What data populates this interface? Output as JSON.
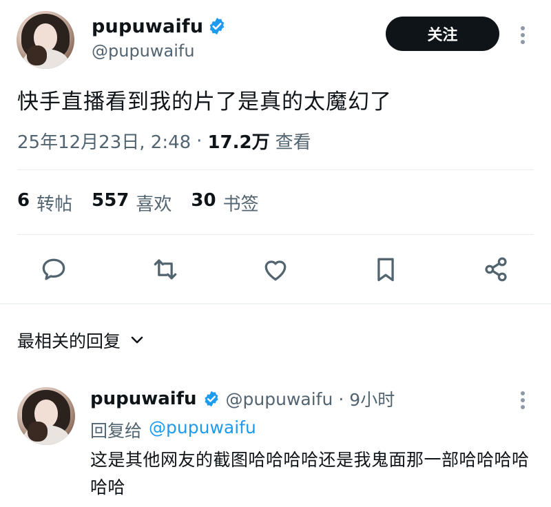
{
  "tweet": {
    "author_name": "pupuwaifu",
    "author_handle": "@pupuwaifu",
    "follow_label": "关注",
    "text": "快手直播看到我的片了是真的太魔幻了",
    "date": "25年12月23日, 2:48",
    "separator": "·",
    "views_count": "17.2万",
    "views_label": "查看",
    "stats": [
      {
        "count": "6",
        "label": "转帖"
      },
      {
        "count": "557",
        "label": "喜欢"
      },
      {
        "count": "30",
        "label": "书签"
      }
    ],
    "actions": [
      "reply-icon",
      "retweet-icon",
      "like-icon",
      "bookmark-icon",
      "share-icon"
    ]
  },
  "replies_section": {
    "title": "最相关的回复"
  },
  "reply": {
    "author_name": "pupuwaifu",
    "author_handle": "@pupuwaifu",
    "separator": "·",
    "time": "9小时",
    "reply_to_prefix": "回复给",
    "reply_to_handle": "@pupuwaifu",
    "text": "这是其他网友的截图哈哈哈哈还是我鬼面那一部哈哈哈哈哈哈"
  },
  "colors": {
    "verified": "#1d9bf0",
    "link": "#1d9bf0",
    "muted": "#536471",
    "primary_text": "#0f1419",
    "button_bg": "#0f1419"
  }
}
